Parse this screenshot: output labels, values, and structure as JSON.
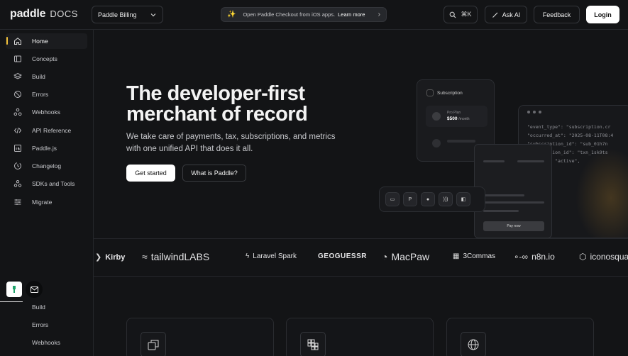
{
  "header": {
    "logo": "paddle",
    "logo_suffix": "DOCS",
    "product_selector": "Paddle Billing",
    "announcement": "Open Paddle Checkout from iOS apps.",
    "announcement_link": "Learn more",
    "search_shortcut": "⌘K",
    "ask_ai": "Ask AI",
    "feedback": "Feedback",
    "login": "Login"
  },
  "sidebar": {
    "items": [
      {
        "label": "Home",
        "icon": "home-icon",
        "active": true
      },
      {
        "label": "Concepts",
        "icon": "book-icon"
      },
      {
        "label": "Build",
        "icon": "layers-icon"
      },
      {
        "label": "Errors",
        "icon": "ban-icon"
      },
      {
        "label": "Webhooks",
        "icon": "webhook-icon"
      },
      {
        "label": "API Reference",
        "icon": "code-icon"
      },
      {
        "label": "Paddle.js",
        "icon": "js-icon"
      },
      {
        "label": "Changelog",
        "icon": "history-icon"
      },
      {
        "label": "SDKs and Tools",
        "icon": "toolbox-icon"
      },
      {
        "label": "Migrate",
        "icon": "migrate-icon"
      }
    ],
    "sub_items": [
      "Build",
      "Errors",
      "Webhooks"
    ]
  },
  "hero": {
    "title_line1": "The developer-first",
    "title_line2": "merchant of record",
    "subtitle": "We take care of payments, tax, subscriptions, and metrics with one unified API that does it all.",
    "cta_primary": "Get started",
    "cta_secondary": "What is Paddle?"
  },
  "illustration": {
    "subscription_title": "Subscription",
    "plan_name": "Pro Plan",
    "plan_price": "$500",
    "plan_period": "/month",
    "code_lines": [
      "\"event_type\": \"subscription.cr",
      "\"occurred_at\": \"2025-08-11T08:4",
      "\"subscription_id\": \"sub_01h7n",
      "\"transaction_id\": \"txn_1sk9ts",
      "\"status\": \"active\","
    ],
    "pay_button": "Pay now"
  },
  "logos": [
    "Kirby",
    "tailwindLABS",
    "Laravel Spark",
    "GEOGUESSR",
    "MacPaw",
    "3Commas",
    "n8n.io",
    "iconosquare"
  ]
}
